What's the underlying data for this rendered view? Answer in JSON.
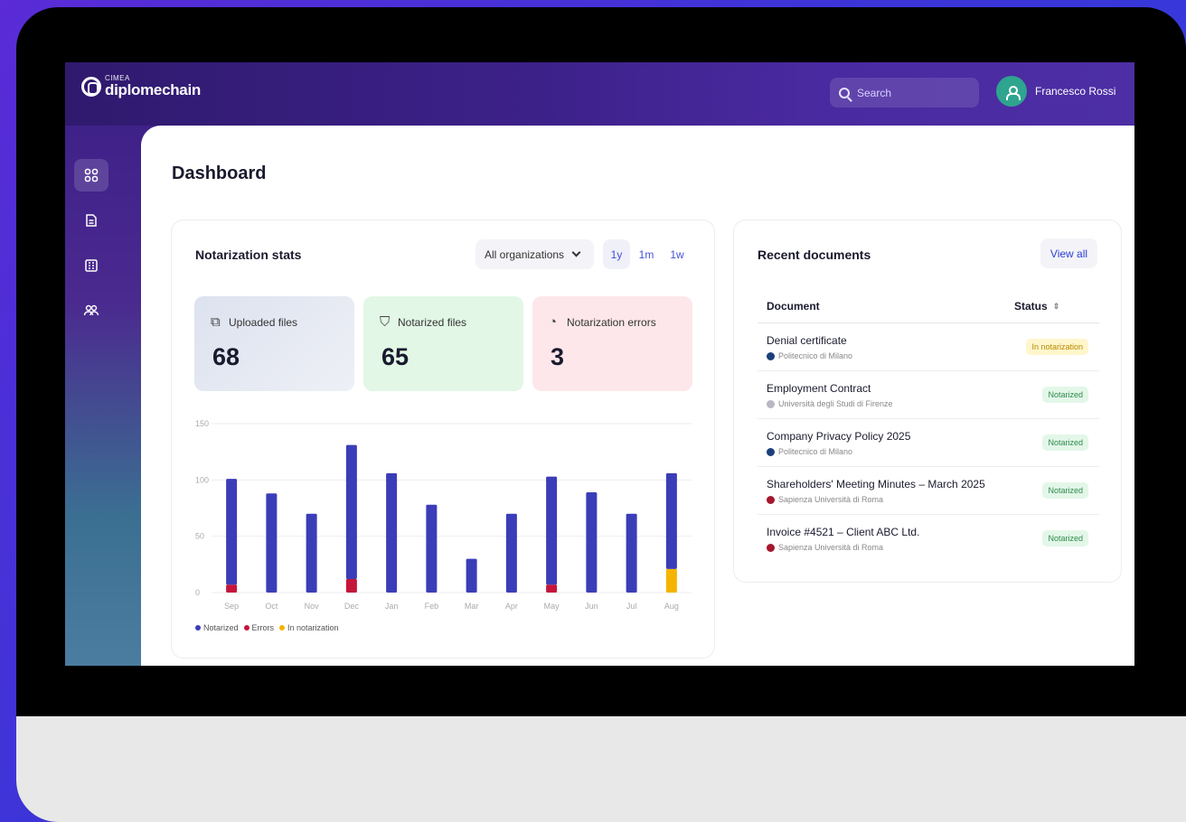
{
  "app": {
    "logo_small": "CIMEA",
    "logo_name": "diplomechain"
  },
  "topbar": {
    "search_placeholder": "Search",
    "user_name": "Francesco Rossi"
  },
  "sidebar": {
    "items": [
      {
        "name": "dashboard",
        "icon": "grid-icon",
        "active": true
      },
      {
        "name": "documents",
        "icon": "document-icon",
        "active": false
      },
      {
        "name": "organizations",
        "icon": "building-icon",
        "active": false
      },
      {
        "name": "users",
        "icon": "users-icon",
        "active": false
      }
    ]
  },
  "page": {
    "title": "Dashboard"
  },
  "stats": {
    "title": "Notarization stats",
    "org_filter": "All organizations",
    "ranges": [
      "1y",
      "1m",
      "1w"
    ],
    "active_range": "1y",
    "kpis": [
      {
        "label": "Uploaded files",
        "value": "68",
        "icon": "upload-icon",
        "color": "#e6e9f2"
      },
      {
        "label": "Notarized files",
        "value": "65",
        "icon": "check-shield-icon",
        "color": "#e3f7e6"
      },
      {
        "label": "Notarization errors",
        "value": "3",
        "icon": "error-clock-icon",
        "color": "#fde8ea"
      }
    ],
    "legend": [
      {
        "label": "Notarized",
        "color": "#3b3db8"
      },
      {
        "label": "Errors",
        "color": "#c4163a"
      },
      {
        "label": "In notarization",
        "color": "#f4b400"
      }
    ]
  },
  "chart_data": {
    "type": "bar",
    "categories": [
      "Sep",
      "Oct",
      "Nov",
      "Dec",
      "Jan",
      "Feb",
      "Mar",
      "Apr",
      "May",
      "Jun",
      "Jul",
      "Aug"
    ],
    "series": [
      {
        "name": "Notarized",
        "values": [
          94,
          88,
          70,
          119,
          106,
          78,
          30,
          70,
          96,
          89,
          70,
          85
        ]
      },
      {
        "name": "Errors",
        "values": [
          7,
          0,
          0,
          12,
          0,
          0,
          0,
          0,
          7,
          0,
          0,
          0
        ]
      },
      {
        "name": "In notarization",
        "values": [
          0,
          0,
          0,
          0,
          0,
          0,
          0,
          0,
          0,
          0,
          0,
          21
        ]
      }
    ],
    "yticks": [
      0,
      50,
      100,
      150
    ],
    "ylim": [
      0,
      150
    ],
    "stacked": true,
    "grid": true,
    "legend_position": "bottom-left",
    "colors": {
      "Notarized": "#3b3db8",
      "Errors": "#c4163a",
      "In notarization": "#f4b400"
    }
  },
  "recent": {
    "title": "Recent documents",
    "view_all": "View all",
    "columns": [
      "Document",
      "Status"
    ],
    "rows": [
      {
        "name": "Denial certificate",
        "org": "Politecnico di Milano",
        "org_color": "#1b3f7a",
        "status": "In notarization",
        "status_type": "pending"
      },
      {
        "name": "Employment Contract",
        "org": "Università degli Studi di Firenze",
        "org_color": "#b8b8c4",
        "status": "Notarized",
        "status_type": "notarized"
      },
      {
        "name": "Company Privacy Policy 2025",
        "org": "Politecnico di Milano",
        "org_color": "#1b3f7a",
        "status": "Notarized",
        "status_type": "notarized"
      },
      {
        "name": "Shareholders' Meeting Minutes – March 2025",
        "org": "Sapienza Università di Roma",
        "org_color": "#a5172c",
        "status": "Notarized",
        "status_type": "notarized"
      },
      {
        "name": "Invoice #4521 – Client ABC Ltd.",
        "org": "Sapienza Università di Roma",
        "org_color": "#a5172c",
        "status": "Notarized",
        "status_type": "notarized"
      }
    ]
  }
}
